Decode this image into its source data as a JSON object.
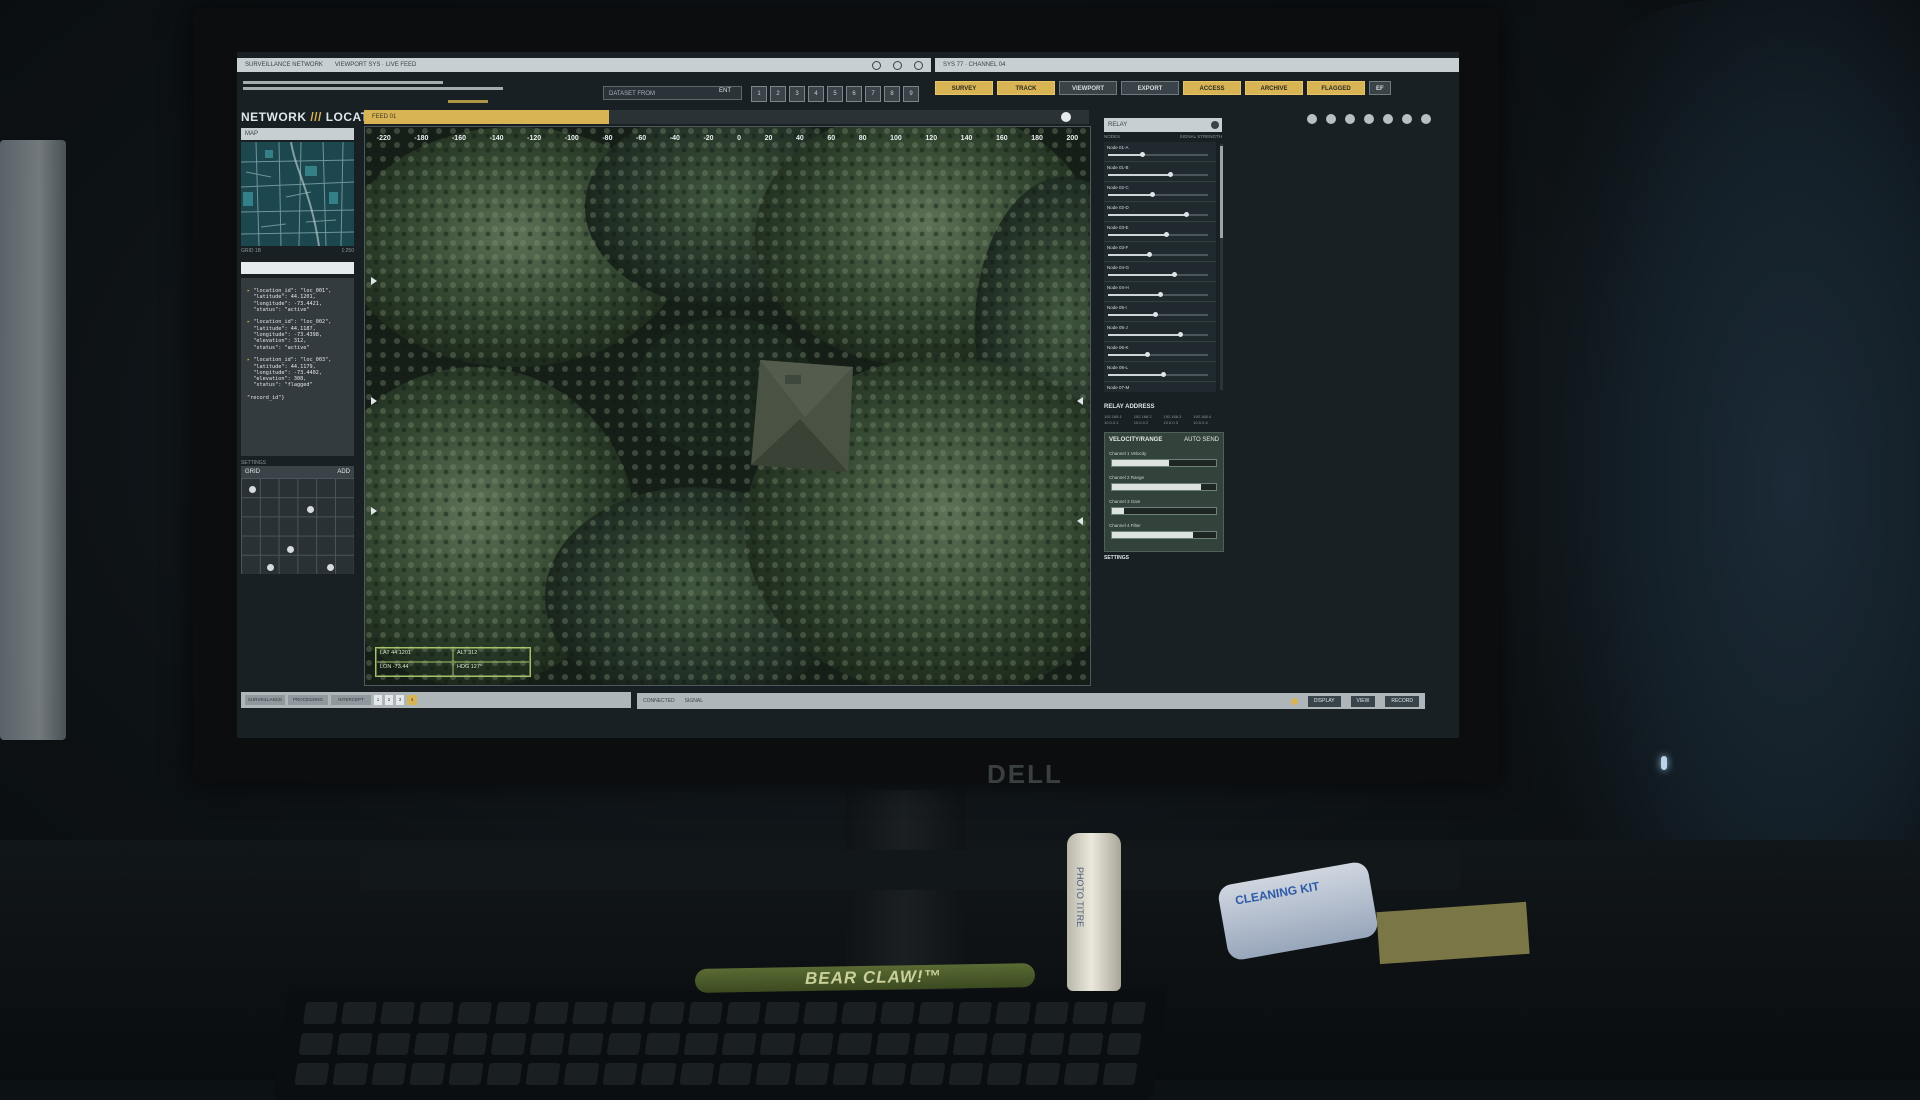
{
  "app": {
    "window_title": "SURVEILLANCE NETWORK",
    "window_subtitle": "VIEWPORT SYS · LIVE FEED",
    "panel_title_right": "SYS 77 · CHANNEL 04",
    "heading_left": "NETWORK",
    "heading_right": "LOCATION DATA",
    "search_placeholder": "DATASET FROM",
    "search_button": "ENT",
    "channels": [
      "1",
      "2",
      "3",
      "4",
      "5",
      "6",
      "7",
      "8",
      "9"
    ]
  },
  "tabs": [
    {
      "label": "SURVEY",
      "active": true
    },
    {
      "label": "TRACK",
      "active": true
    },
    {
      "label": "VIEWPORT",
      "active": false
    },
    {
      "label": "EXPORT",
      "active": false
    },
    {
      "label": "ACCESS",
      "active": true
    },
    {
      "label": "ARCHIVE",
      "active": true
    },
    {
      "label": "FLAGGED",
      "active": true
    },
    {
      "label": "EF",
      "active": false
    }
  ],
  "left_panel": {
    "map_header": "MAP",
    "map_footer_left": "GRID 1B",
    "map_footer_right": "1:250",
    "code_header": "",
    "code_lines": [
      "\"location_id\": \"loc_001\",",
      "  \"latitude\": 44.1201,",
      "  \"longitude\": -73.4421,",
      "  \"status\": \"active\"",
      "",
      "\"location_id\": \"loc_002\",",
      "  \"latitude\": 44.1187,",
      "  \"longitude\": -73.4398,",
      "  \"elevation\": 312,",
      "  \"status\": \"active\"",
      "",
      "\"location_id\": \"loc_003\",",
      "  \"latitude\": 44.1179,",
      "  \"longitude\": -73.4402,",
      "  \"elevation\": 308,",
      "  \"status\": \"flagged\"",
      "",
      "\"record_id\"}"
    ],
    "grid_label": "SETTINGS",
    "grid_header_left": "GRID",
    "grid_header_right": "ADD"
  },
  "viewport": {
    "tab_label": "FEED 01",
    "ruler_ticks": [
      "-220",
      "-180",
      "-160",
      "-140",
      "-120",
      "-100",
      "-80",
      "-60",
      "-40",
      "-20",
      "0",
      "20",
      "40",
      "60",
      "80",
      "100",
      "120",
      "140",
      "160",
      "180",
      "200"
    ],
    "coords": [
      "LAT 44.1201",
      "ALT 312",
      "LON -73.44",
      "HDG 127°"
    ]
  },
  "right_panel": {
    "header": "RELAY",
    "sub_left": "NODES",
    "sub_right": "SIGNAL STRENGTH",
    "rows": [
      {
        "label": "Node 01-A",
        "level": 0.34
      },
      {
        "label": "Node 01-B",
        "level": 0.62
      },
      {
        "label": "Node 02-C",
        "level": 0.44
      },
      {
        "label": "Node 02-D",
        "level": 0.78
      },
      {
        "label": "Node 03-E",
        "level": 0.58
      },
      {
        "label": "Node 03-F",
        "level": 0.41
      },
      {
        "label": "Node 04-G",
        "level": 0.66
      },
      {
        "label": "Node 04-H",
        "level": 0.52
      },
      {
        "label": "Node 05-I",
        "level": 0.47
      },
      {
        "label": "Node 05-J",
        "level": 0.72
      },
      {
        "label": "Node 06-K",
        "level": 0.39
      },
      {
        "label": "Node 06-L",
        "level": 0.55
      },
      {
        "label": "Node 07-M",
        "level": 0.63
      }
    ],
    "relay_title": "RELAY ADDRESS",
    "relay_cells": [
      "192.168.1",
      "192.168.2",
      "192.168.3",
      "192.168.4",
      "10.0.0.1",
      "10.0.0.2",
      "10.0.0.3",
      "10.0.0.4"
    ],
    "velocity_title": "VELOCITY/RANGE",
    "velocity_auto": "AUTO SEND",
    "sliders": [
      {
        "label": "Channel 1 Velocity",
        "level": 0.55
      },
      {
        "label": "Channel 2 Range",
        "level": 0.86
      },
      {
        "label": "Channel 3 Gain",
        "level": 0.12
      },
      {
        "label": "Channel 4 Filter",
        "level": 0.78
      }
    ],
    "settings_label": "SETTINGS"
  },
  "bottom": {
    "left_buttons": [
      "SURVEILLANCE",
      "PROCESSING",
      "INTERCEPT"
    ],
    "left_small": [
      "1",
      "2",
      "3",
      "4"
    ],
    "main_text": "CONNECTED",
    "main_text2": "SIGNAL",
    "buttons": [
      "DISPLAY",
      "VIEW",
      "RECORD"
    ]
  },
  "monitor": {
    "brand": "DELL"
  },
  "desk": {
    "pen_label": "BEAR CLAW!™",
    "bottle_label": "PHOTO TITRE",
    "kit_label": "CLEANING KIT"
  },
  "colors": {
    "accent": "#d9b454",
    "panel": "#c8cfd3",
    "screen_bg": "#182024"
  }
}
